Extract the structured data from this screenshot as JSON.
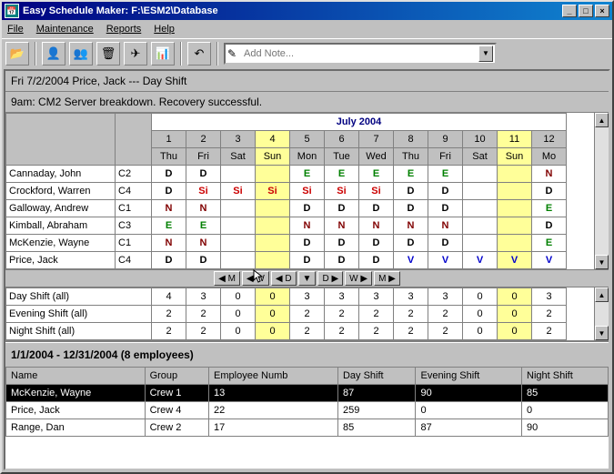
{
  "title": "Easy Schedule Maker: F:\\ESM2\\Database",
  "menu": {
    "file": "File",
    "maint": "Maintenance",
    "reports": "Reports",
    "help": "Help"
  },
  "toolbar": {
    "addnote_placeholder": "Add Note..."
  },
  "info": "Fri 7/2/2004 Price, Jack --- Day Shift",
  "note": "9am: CM2 Server breakdown. Recovery successful.",
  "month": "July 2004",
  "daynums": [
    "1",
    "2",
    "3",
    "4",
    "5",
    "6",
    "7",
    "8",
    "9",
    "10",
    "11",
    "12"
  ],
  "daynames": [
    "Thu",
    "Fri",
    "Sat",
    "Sun",
    "Mon",
    "Tue",
    "Wed",
    "Thu",
    "Fri",
    "Sat",
    "Sun",
    "Mo"
  ],
  "sundays": [
    3,
    10
  ],
  "rows": [
    {
      "name": "Cannaday, John",
      "grp": "C2",
      "cells": [
        "D",
        "D",
        "",
        "",
        "E",
        "E",
        "E",
        "E",
        "E",
        "",
        "",
        "N"
      ]
    },
    {
      "name": "Crockford, Warren",
      "grp": "C4",
      "cells": [
        "D",
        "Si",
        "Si",
        "Si",
        "Si",
        "Si",
        "Si",
        "D",
        "D",
        "",
        "",
        "D"
      ]
    },
    {
      "name": "Galloway, Andrew",
      "grp": "C1",
      "cells": [
        "N",
        "N",
        "",
        "",
        "D",
        "D",
        "D",
        "D",
        "D",
        "",
        "",
        "E"
      ]
    },
    {
      "name": "Kimball, Abraham",
      "grp": "C3",
      "cells": [
        "E",
        "E",
        "",
        "",
        "N",
        "N",
        "N",
        "N",
        "N",
        "",
        "",
        "D"
      ]
    },
    {
      "name": "McKenzie, Wayne",
      "grp": "C1",
      "cells": [
        "N",
        "N",
        "",
        "",
        "D",
        "D",
        "D",
        "D",
        "D",
        "",
        "",
        "E"
      ]
    },
    {
      "name": "Price, Jack",
      "grp": "C4",
      "cells": [
        "D",
        "D",
        "",
        "",
        "D",
        "D",
        "D",
        "V",
        "V",
        "V",
        "V",
        "V"
      ]
    }
  ],
  "nav": [
    "◀ M",
    "◀ W",
    "◀ D",
    "▼",
    "D ▶",
    "W ▶",
    "M ▶"
  ],
  "sums": [
    {
      "name": "Day Shift (all)",
      "vals": [
        "4",
        "3",
        "0",
        "0",
        "3",
        "3",
        "3",
        "3",
        "3",
        "0",
        "0",
        "3"
      ]
    },
    {
      "name": "Evening Shift (all)",
      "vals": [
        "2",
        "2",
        "0",
        "0",
        "2",
        "2",
        "2",
        "2",
        "2",
        "0",
        "0",
        "2"
      ]
    },
    {
      "name": "Night Shift (all)",
      "vals": [
        "2",
        "2",
        "0",
        "0",
        "2",
        "2",
        "2",
        "2",
        "2",
        "0",
        "0",
        "2"
      ]
    }
  ],
  "summary_title": "1/1/2004 - 12/31/2004 (8 employees)",
  "emp_hdr": {
    "name": "Name",
    "group": "Group",
    "num": "Employee Numb",
    "day": "Day Shift",
    "eve": "Evening Shift",
    "night": "Night Shift"
  },
  "emps": [
    {
      "name": "McKenzie, Wayne",
      "group": "Crew 1",
      "num": "13",
      "day": "87",
      "eve": "90",
      "night": "85",
      "sel": true
    },
    {
      "name": "Price, Jack",
      "group": "Crew 4",
      "num": "22",
      "day": "259",
      "eve": "0",
      "night": "0",
      "sel": false
    },
    {
      "name": "Range, Dan",
      "group": "Crew 2",
      "num": "17",
      "day": "85",
      "eve": "87",
      "night": "90",
      "sel": false
    }
  ]
}
